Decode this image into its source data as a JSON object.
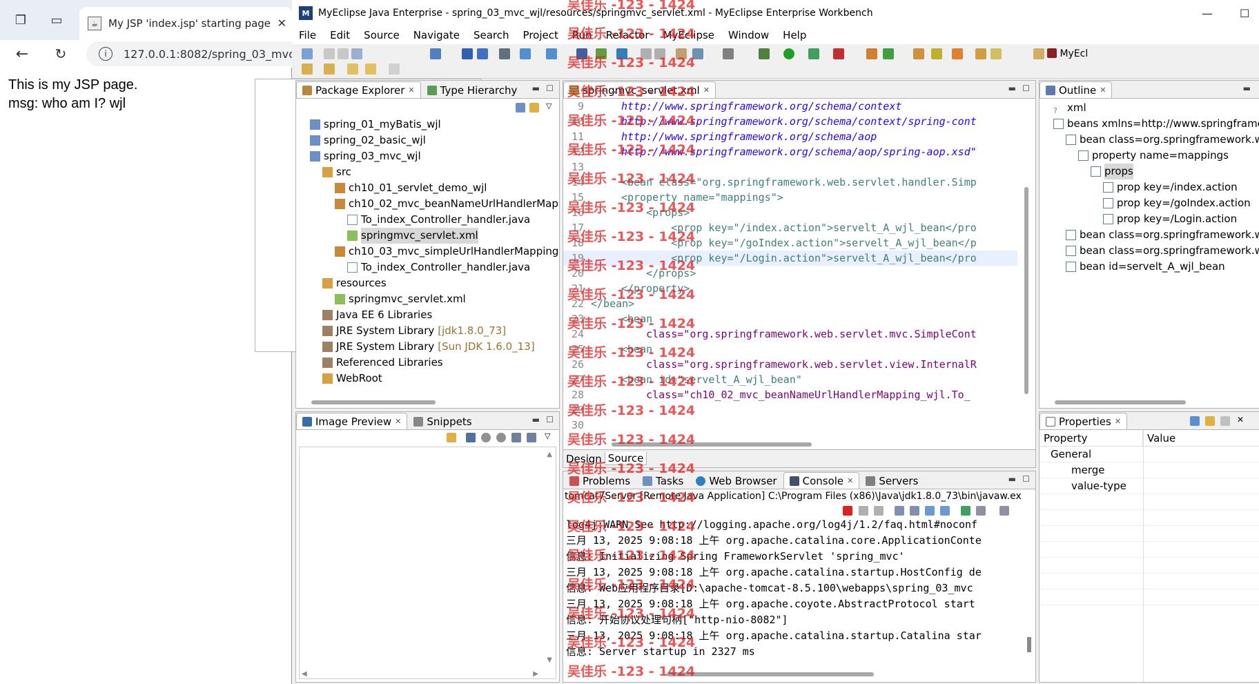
{
  "browser": {
    "tab_title": "My JSP 'index.jsp' starting page",
    "url": "127.0.0.1:8082/spring_03_mvc_",
    "content_lines": [
      "This is my JSP page.",
      "msg: who am I? wjl"
    ]
  },
  "ide": {
    "window_title": "MyEclipse Java Enterprise - spring_03_mvc_wjl/resources/springmvc_servlet.xml - MyEclipse Enterprise Workbench",
    "menu": [
      "File",
      "Edit",
      "Source",
      "Navigate",
      "Search",
      "Project",
      "Run",
      "Refactor",
      "MyEclipse",
      "Window",
      "Help"
    ],
    "perspective_label": "MyEcl",
    "package_explorer": {
      "tabs": [
        "Package Explorer",
        "Type Hierarchy"
      ],
      "items": [
        {
          "label": "spring_01_myBatis_wjl",
          "suffix": ""
        },
        {
          "label": "spring_02_basic_wjl",
          "suffix": ""
        },
        {
          "label": "spring_03_mvc_wjl",
          "suffix": ""
        },
        {
          "label": "src",
          "suffix": ""
        },
        {
          "label": "ch10_01_servlet_demo_wjl",
          "suffix": ""
        },
        {
          "label": "ch10_02_mvc_beanNameUrlHandlerMap",
          "suffix": ""
        },
        {
          "label": "To_index_Controller_handler.java",
          "suffix": ""
        },
        {
          "label": "springmvc_servlet.xml",
          "suffix": ""
        },
        {
          "label": "ch10_03_mvc_simpleUrlHandlerMapping",
          "suffix": ""
        },
        {
          "label": "To_index_Controller_handler.java",
          "suffix": ""
        },
        {
          "label": "resources",
          "suffix": ""
        },
        {
          "label": "springmvc_servlet.xml",
          "suffix": ""
        },
        {
          "label": "Java EE 6 Libraries",
          "suffix": ""
        },
        {
          "label": "JRE System Library",
          "suffix": "[jdk1.8.0_73]"
        },
        {
          "label": "JRE System Library",
          "suffix": "[Sun JDK 1.6.0_13]"
        },
        {
          "label": "Referenced Libraries",
          "suffix": ""
        },
        {
          "label": "WebRoot",
          "suffix": ""
        }
      ]
    },
    "image_preview": {
      "tabs": [
        "Image Preview",
        "Snippets"
      ]
    },
    "editor": {
      "tab": "springmvc_servlet.xml",
      "bottom_tabs": [
        "Design",
        "Source"
      ],
      "lines": [
        {
          "n": "9",
          "code": "http://www.springframework.org/schema/context"
        },
        {
          "n": "10",
          "code": "http://www.springframework.org/schema/context/spring-cont"
        },
        {
          "n": "11",
          "code": "http://www.springframework.org/schema/aop"
        },
        {
          "n": "12",
          "code": "http://www.springframework.org/schema/aop/spring-aop.xsd\""
        },
        {
          "n": "13",
          "code": ""
        },
        {
          "n": "14",
          "code": "<bean class=\"org.springframework.web.servlet.handler.Simp"
        },
        {
          "n": "15",
          "code": "<property name=\"mappings\">"
        },
        {
          "n": "16",
          "code": "    <props>"
        },
        {
          "n": "17",
          "code": "        <prop key=\"/index.action\">servelt_A_wjl_bean</pro"
        },
        {
          "n": "18",
          "code": "        <prop key=\"/goIndex.action\">servelt_A_wjl_bean</p"
        },
        {
          "n": "19",
          "code": "        <prop key=\"/Login.action\">servelt_A_wjl_bean</pro"
        },
        {
          "n": "20",
          "code": "    </props>"
        },
        {
          "n": "21",
          "code": "</property>"
        },
        {
          "n": "22",
          "code": "</bean>"
        },
        {
          "n": "23",
          "code": "<bean"
        },
        {
          "n": "24",
          "code": "    class=\"org.springframework.web.servlet.mvc.SimpleCont"
        },
        {
          "n": "25",
          "code": "<bean"
        },
        {
          "n": "26",
          "code": "    class=\"org.springframework.web.servlet.view.InternalR"
        },
        {
          "n": "27",
          "code": "<bean id=\"servelt_A_wjl_bean\""
        },
        {
          "n": "28",
          "code": "    class=\"ch10_02_mvc_beanNameUrlHandlerMapping_wjl.To_"
        },
        {
          "n": "29",
          "code": ""
        },
        {
          "n": "30",
          "code": ""
        }
      ]
    },
    "outline": {
      "tab": "Outline",
      "items": [
        "xml",
        "beans xmlns=http://www.springframe",
        "bean class=org.springframework.w",
        "property name=mappings",
        "props",
        "prop key=/index.action",
        "prop key=/goIndex.action",
        "prop key=/Login.action",
        "bean class=org.springframework.w",
        "bean class=org.springframework.w",
        "bean id=servelt_A_wjl_bean"
      ]
    },
    "properties": {
      "tab": "Properties",
      "col_property": "Property",
      "col_value": "Value",
      "rows": [
        "General",
        "merge",
        "value-type"
      ]
    },
    "console": {
      "tabs": [
        "Problems",
        "Tasks",
        "Web Browser",
        "Console",
        "Servers"
      ],
      "header": "tomcat7Server [Remote Java Application] C:\\Program Files (x86)\\Java\\jdk1.8.0_73\\bin\\javaw.ex",
      "lines": [
        "log4j:WARN See http://logging.apache.org/log4j/1.2/faq.html#noconf",
        "三月 13, 2025 9:08:18 上午 org.apache.catalina.core.ApplicationConte",
        "信息: Initializing Spring FrameworkServlet 'spring_mvc'",
        "三月 13, 2025 9:08:18 上午 org.apache.catalina.startup.HostConfig de",
        "信息: Web应用程序目录[D:\\apache-tomcat-8.5.100\\webapps\\spring_03_mvc",
        "三月 13, 2025 9:08:18 上午 org.apache.coyote.AbstractProtocol start",
        "信息: 开始协议处理句柄[\"http-nio-8082\"]",
        "三月 13, 2025 9:08:18 上午 org.apache.catalina.startup.Catalina star",
        "信息: Server startup in 2327 ms"
      ]
    }
  },
  "watermark": "吴佳乐 -123 - 1424",
  "colors": {
    "watermark": "#e61e1e",
    "string": "#2a00ff",
    "tag": "#3f7f7f",
    "attr": "#7f007f"
  }
}
